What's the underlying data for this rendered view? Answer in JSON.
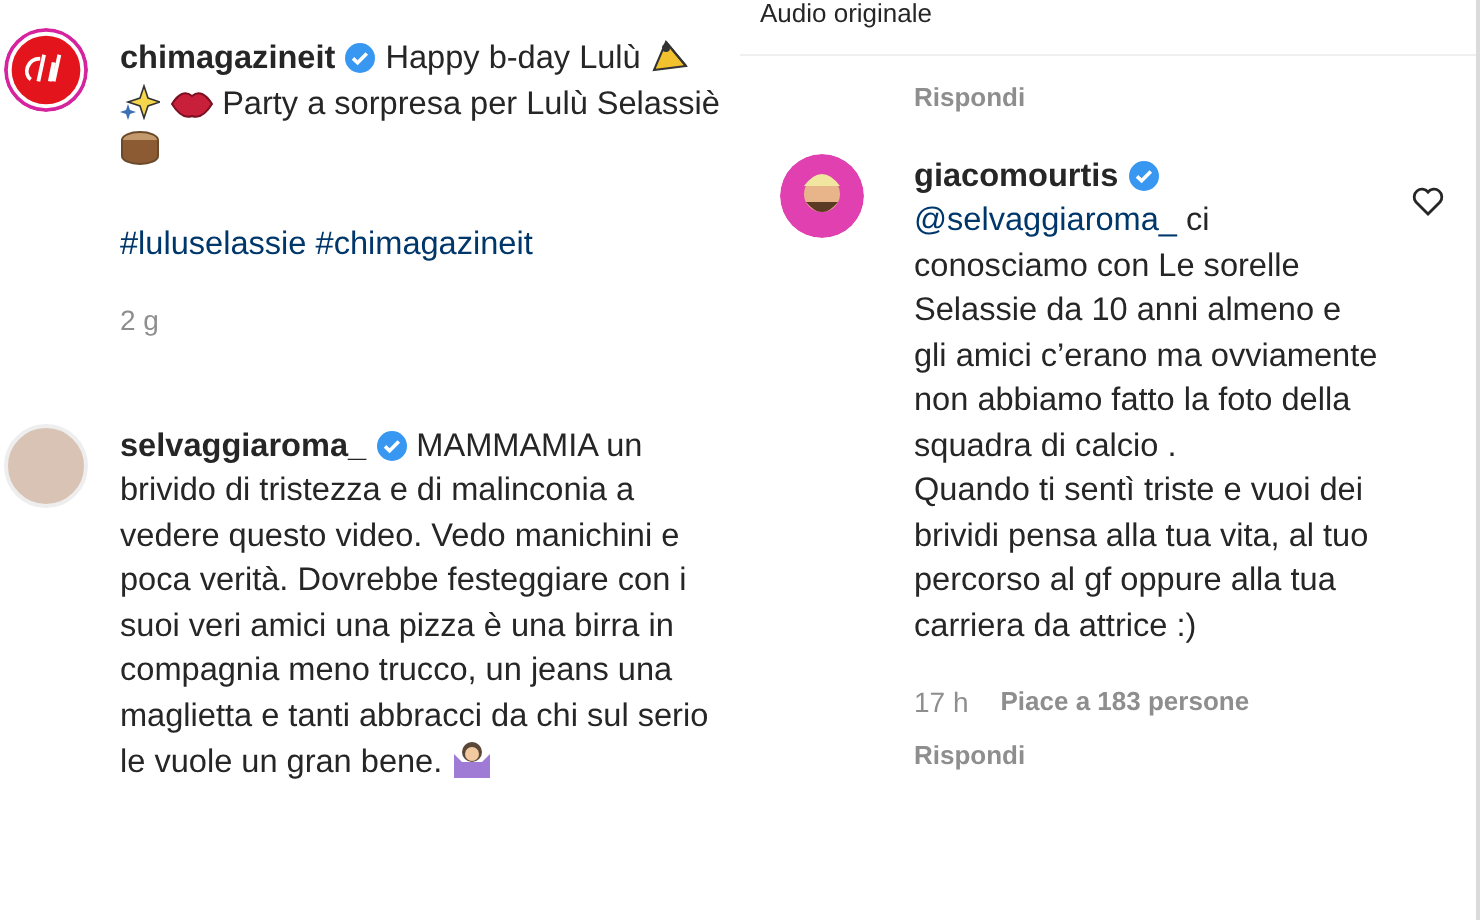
{
  "post": {
    "username": "chimagazineit",
    "verified": true,
    "caption": [
      {
        "kind": "text",
        "text": "Happy b-day Lulù"
      },
      {
        "kind": "party-hat"
      },
      {
        "kind": "sparkles"
      },
      {
        "kind": "lips"
      },
      {
        "kind": "text",
        "text": "Party a sorpresa per Lulù Selassiè"
      },
      {
        "kind": "cake"
      }
    ],
    "hashtags": [
      "#luluselassie",
      "#chimagazineit"
    ],
    "time": "2 g"
  },
  "left_comments": [
    {
      "username": "selvaggiaroma_",
      "verified": true,
      "text": "MAMMAMIA un brivido di tristezza e di malinconia a vedere questo video. Vedo manichini e poca verità. Dovrebbe festeggiare con i suoi veri amici una pizza è una birra in compagnia meno trucco, un jeans una maglietta e tanti abbracci da chi sul serio le vuole un gran bene.",
      "emoji": {
        "kind": "shrug"
      }
    }
  ],
  "right_panel": {
    "audio_label": "Audio originale",
    "reply_link": "Rispondi",
    "comments": [
      {
        "username": "giacomourtis",
        "verified": true,
        "mention": "@selvaggiaroma_",
        "text": " ci conosciamo con Le sorelle Selassie da 10 anni almeno e gli amici c’erano ma ovviamente non abbiamo fatto la foto della squadra di calcio .\nQuando ti sentì triste e vuoi dei brividi pensa alla tua vita, al tuo percorso al gf oppure alla tua carriera da attrice :)",
        "liked": false,
        "time": "17 h",
        "likes": "Piace a 183 persone",
        "reply": "Rispondi"
      }
    ]
  }
}
